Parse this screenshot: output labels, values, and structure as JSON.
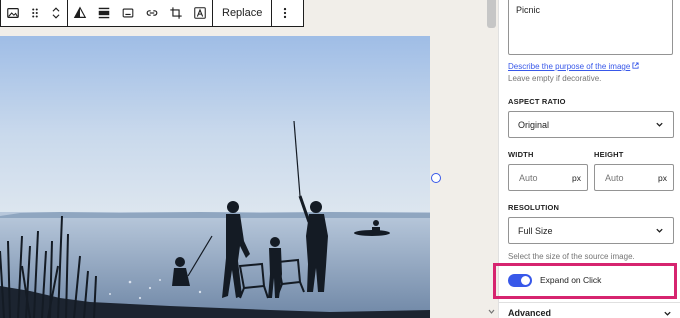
{
  "toolbar": {
    "icons": [
      "image-icon",
      "drag-handle-icon",
      "move-up-down-icon",
      "duotone-filter-icon",
      "align-icon",
      "caption-icon",
      "link-icon",
      "crop-icon",
      "text-over-image-icon"
    ],
    "replace_label": "Replace",
    "more_icon": "more-vertical-icon"
  },
  "image": {
    "description": "Silhouettes of people fishing and sitting at a lakeshore"
  },
  "sidebar": {
    "alt_text": {
      "value": "Picnic",
      "describe_link": "Describe the purpose of the image",
      "help": "Leave empty if decorative."
    },
    "aspect_ratio": {
      "label": "ASPECT RATIO",
      "value": "Original"
    },
    "width": {
      "label": "WIDTH",
      "placeholder": "Auto",
      "unit": "px"
    },
    "height": {
      "label": "HEIGHT",
      "placeholder": "Auto",
      "unit": "px"
    },
    "resolution": {
      "label": "RESOLUTION",
      "value": "Full Size",
      "help": "Select the size of the source image."
    },
    "expand_on_click": {
      "label": "Expand on Click",
      "checked": true
    },
    "advanced": {
      "label": "Advanced"
    }
  },
  "colors": {
    "accent": "#3858e9",
    "highlight": "#d6246f"
  }
}
